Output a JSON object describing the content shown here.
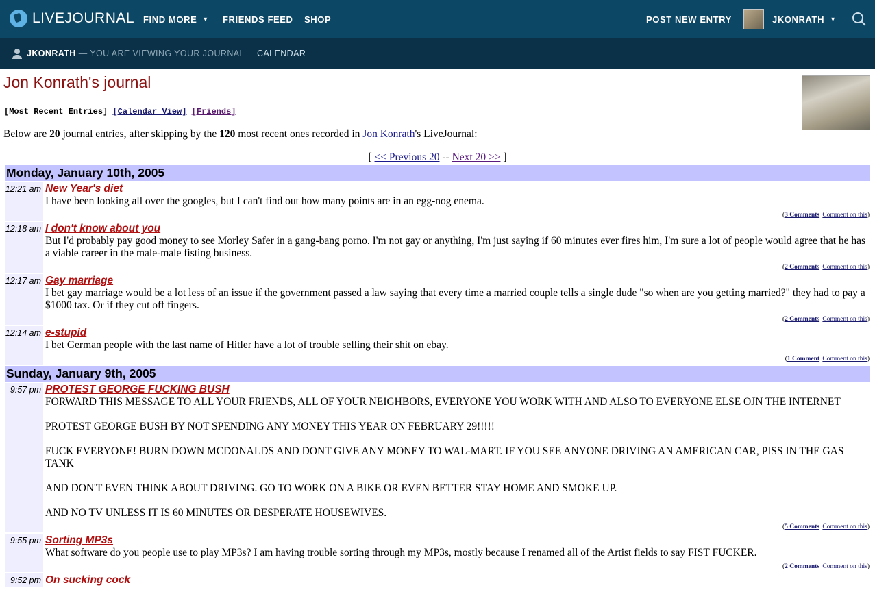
{
  "topnav": {
    "brand": "LIVEJOURNAL",
    "find_more": "FIND MORE",
    "friends_feed": "FRIENDS FEED",
    "shop": "SHOP",
    "post_new_entry": "POST NEW ENTRY",
    "username": "JKONRATH"
  },
  "subnav": {
    "user": "JKONRATH",
    "viewing_text": "— YOU ARE VIEWING YOUR JOURNAL",
    "calendar": "CALENDAR"
  },
  "journal": {
    "title": "Jon Konrath's journal",
    "view_current": "[Most Recent Entries]",
    "view_calendar": "[Calendar View]",
    "view_friends": "[Friends]",
    "intro": {
      "pre": "Below are ",
      "count": "20",
      "mid": " journal entries, after skipping by the ",
      "skip": "120",
      "mid2": " most recent ones recorded in ",
      "owner_link": "Jon Konrath",
      "post": "'s LiveJournal:"
    },
    "pager": {
      "open": "[ ",
      "prev": "<< Previous 20",
      "sep": " -- ",
      "next": "Next 20 >>",
      "close": " ]"
    }
  },
  "days": [
    {
      "date": "Monday, January 10th, 2005",
      "entries": [
        {
          "time": "12:21 am",
          "subject": "New Year's diet",
          "body": "I have been looking all over the googles, but I can't find out how many points are in an egg-nog enema.",
          "comments": "3 Comments",
          "comment_on": "Comment on this"
        },
        {
          "time": "12:18 am",
          "subject": "I don't know about you",
          "body": "But I'd probably pay good money to see Morley Safer in a gang-bang porno. I'm not gay or anything, I'm just saying if 60 minutes ever fires him, I'm sure a lot of people would agree that he has a viable career in the male-male fisting business.",
          "comments": "2 Comments",
          "comment_on": "Comment on this"
        },
        {
          "time": "12:17 am",
          "subject": "Gay marriage",
          "body": "I bet gay marriage would be a lot less of an issue if the government passed a law saying that every time a married couple tells a single dude \"so when are you getting married?\" they had to pay a $1000 tax. Or if they cut off fingers.",
          "comments": "2 Comments",
          "comment_on": "Comment on this"
        },
        {
          "time": "12:14 am",
          "subject": "e-stupid",
          "body": "I bet German people with the last name of Hitler have a lot of trouble selling their shit on ebay.",
          "comments": "1 Comment",
          "comment_on": "Comment on this"
        }
      ]
    },
    {
      "date": "Sunday, January 9th, 2005",
      "entries": [
        {
          "time": "9:57 pm",
          "subject": "PROTEST GEORGE FUCKING BUSH",
          "body": "FORWARD THIS MESSAGE TO ALL YOUR FRIENDS, ALL OF YOUR NEIGHBORS, EVERYONE YOU WORK WITH AND ALSO TO EVERYONE ELSE OJN THE INTERNET\n\nPROTEST GEORGE BUSH BY NOT SPENDING ANY MONEY THIS YEAR ON FEBRUARY 29!!!!!\n\nFUCK EVERYONE! BURN DOWN MCDONALDS AND DONT GIVE ANY MONEY TO WAL-MART. IF YOU SEE ANYONE DRIVING AN AMERICAN CAR, PISS IN THE GAS TANK\n\nAND DON'T EVEN THINK ABOUT DRIVING. GO TO WORK ON A BIKE OR EVEN BETTER STAY HOME AND SMOKE UP.\n\nAND NO TV UNLESS IT IS 60 MINUTES OR DESPERATE HOUSEWIVES.",
          "comments": "5 Comments",
          "comment_on": "Comment on this"
        },
        {
          "time": "9:55 pm",
          "subject": "Sorting MP3s",
          "body": "What software do you people use to play MP3s? I am having trouble sorting through my MP3s, mostly because I renamed all of the Artist fields to say FIST FUCKER.",
          "comments": "2 Comments",
          "comment_on": "Comment on this"
        },
        {
          "time": "9:52 pm",
          "subject": "On sucking cock",
          "body": "",
          "comments": "",
          "comment_on": ""
        }
      ]
    }
  ],
  "colors": {
    "topbar": "#0d4766",
    "subbar": "#0a3147",
    "day_header": "#c3c3ff",
    "time_column": "#eeeeff",
    "subject": "#b01010",
    "title": "#8b1010"
  },
  "icons": {
    "logo": "livejournal-logo-icon",
    "search": "search-icon",
    "user": "user-icon",
    "caret": "chevron-down-icon"
  }
}
